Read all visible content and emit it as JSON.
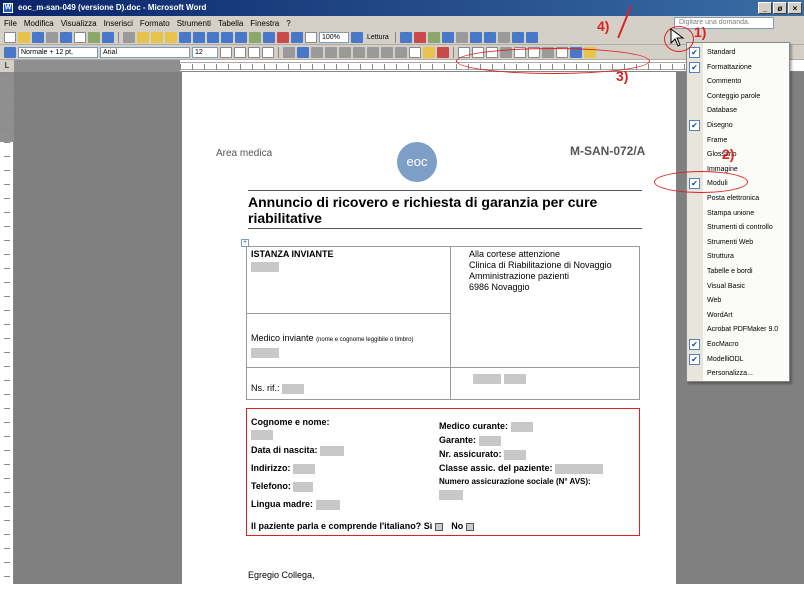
{
  "window": {
    "title": "eoc_m-san-049 (versione D).doc - Microsoft Word",
    "title_icon": "word-doc-icon",
    "buttons": [
      "_",
      "ø",
      "×"
    ]
  },
  "menubar": {
    "items": [
      "File",
      "Modifica",
      "Visualizza",
      "Inserisci",
      "Formato",
      "Strumenti",
      "Tabella",
      "Finestra",
      "?"
    ],
    "ask_placeholder": "Digitare una domanda."
  },
  "toolbar_standard": {
    "zoom": "100%",
    "lettura_label": "Lettura"
  },
  "toolbar_format": {
    "style": "Normale + 12 pt,",
    "font": "Arial",
    "size": "12"
  },
  "document": {
    "header_left": "Area medica",
    "logo_text": "eoc",
    "header_code": "M-SAN-072/A",
    "title": "Annuncio di ricovero e richiesta di garanzia per cure riabilitative",
    "istanza_label": "ISTANZA INVIANTE",
    "address_lines": [
      "Alla cortese attenzione",
      "Clinica di Riabilitazione di Novaggio",
      "Amministrazione pazienti",
      "6986 Novaggio"
    ],
    "medico_inviante_label": "Medico inviante",
    "medico_inviante_note": "(nome e cognome leggibile o timbro)",
    "ns_rif_label": "Ns. rif.:",
    "fields_left": [
      "Cognome e nome:",
      "Data di nascita:",
      "Indirizzo:",
      "Telefono:",
      "Lingua madre:"
    ],
    "fields_right": [
      "Medico curante:",
      "Garante:",
      "Nr. assicurato:",
      "Classe assic. del paziente:",
      "Numero assicurazione sociale (N° AVS):"
    ],
    "italian_question": "Il paziente parla e comprende l'italiano?",
    "si_label": "Sì",
    "no_label": "No",
    "body_start": "Egregio Collega,"
  },
  "toolbars_menu": {
    "items": [
      {
        "label": "Standard",
        "checked": true
      },
      {
        "label": "Formattazione",
        "checked": true
      },
      {
        "label": "Commento",
        "checked": false
      },
      {
        "label": "Conteggio parole",
        "checked": false
      },
      {
        "label": "Database",
        "checked": false
      },
      {
        "label": "Disegno",
        "checked": true
      },
      {
        "label": "Frame",
        "checked": false
      },
      {
        "label": "Glossario",
        "checked": false
      },
      {
        "label": "Immagine",
        "checked": false
      },
      {
        "label": "Moduli",
        "checked": true
      },
      {
        "label": "Posta elettronica",
        "checked": false
      },
      {
        "label": "Stampa unione",
        "checked": false
      },
      {
        "label": "Strumenti di controllo",
        "checked": false
      },
      {
        "label": "Strumenti Web",
        "checked": false
      },
      {
        "label": "Struttura",
        "checked": false
      },
      {
        "label": "Tabelle e bordi",
        "checked": false
      },
      {
        "label": "Visual Basic",
        "checked": false
      },
      {
        "label": "Web",
        "checked": false
      },
      {
        "label": "WordArt",
        "checked": false
      },
      {
        "label": "Acrobat PDFMaker 9.0",
        "checked": false
      },
      {
        "label": "EocMacro",
        "checked": true
      },
      {
        "label": "ModelliODL",
        "checked": true
      },
      {
        "label": "Personalizza...",
        "checked": false
      }
    ]
  },
  "annotations": {
    "a1": "1)",
    "a2": "2)",
    "a3": "3)",
    "a4": "4)"
  },
  "colors": {
    "annotation": "#dd2222",
    "titlebar": "#0a246a"
  }
}
